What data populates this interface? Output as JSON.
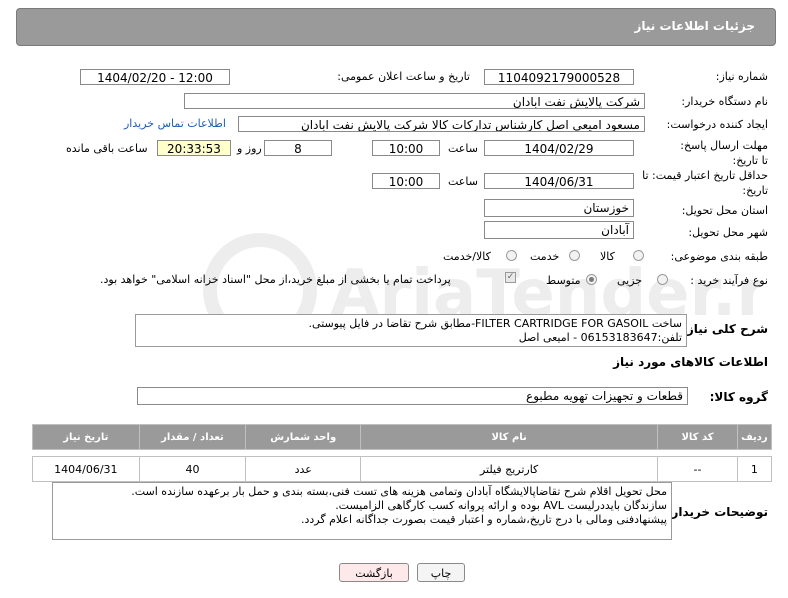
{
  "header": {
    "title": "جزئیات اطلاعات نیاز"
  },
  "fields": {
    "need_number_label": "شماره نیاز:",
    "need_number": "1104092179000528",
    "announce_label": "تاریخ و ساعت اعلان عمومی:",
    "announce_value": "1404/02/20 - 12:00",
    "buyer_org_label": "نام دستگاه خریدار:",
    "buyer_org": "شرکت پالایش نفت ابادان",
    "creator_label": "ایجاد کننده درخواست:",
    "creator": "مسعود امیعی اصل کارشناس تدارکات کالا  شرکت پالایش نفت ابادان",
    "contact_link": "اطلاعات تماس خریدار",
    "reply_deadline_label": "مهلت ارسال پاسخ: تا تاریخ:",
    "reply_date": "1404/02/29",
    "time_label": "ساعت",
    "reply_time": "10:00",
    "days": "8",
    "days_label": "روز و",
    "remaining_time": "20:33:53",
    "remaining_label": "ساعت باقی مانده",
    "price_validity_label": "حداقل تاریخ اعتبار قیمت: تا تاریخ:",
    "price_date": "1404/06/31",
    "price_time_label": "ساعت",
    "price_time": "10:00",
    "province_label": "استان محل تحویل:",
    "province": "خوزستان",
    "city_label": "شهر محل تحویل:",
    "city": "آبادان",
    "category_label": "طبقه بندی موضوعی:",
    "category_options": [
      "کالا",
      "خدمت",
      "کالا/خدمت"
    ],
    "process_label": "نوع فرآیند خرید :",
    "process_options": [
      "جزیی",
      "متوسط"
    ],
    "payment_note": "پرداخت تمام یا بخشی از مبلغ خرید،از محل \"اسناد خزانه اسلامی\" خواهد بود.",
    "description_label": "شرح کلی نیاز:",
    "description_line1": "ساخت FILTER CARTRIDGE FOR GASOIL-مطابق شرح تقاضا در فایل پیوستی.",
    "description_line2": "تلفن:06153183647 - امیعی اصل"
  },
  "goods": {
    "section_title": "اطلاعات کالاهای مورد نیاز",
    "group_label": "گروه کالا:",
    "group_value": "قطعات و تجهیزات تهویه مطبوع",
    "columns": [
      "ردیف",
      "کد کالا",
      "نام کالا",
      "واحد شمارش",
      "تعداد / مقدار",
      "تاریخ نیاز"
    ],
    "rows": [
      {
        "row": "1",
        "code": "--",
        "name": "کارتریج فیلتر",
        "unit": "عدد",
        "qty": "40",
        "date": "1404/06/31"
      }
    ]
  },
  "buyer_notes": {
    "label": "توضیحات خریدار:",
    "line1": "محل تحویل اقلام شرح تقاضاپالایشگاه آبادان وتمامی هزینه های تست فنی،بسته بندی و حمل بار برعهده سازنده است.",
    "line2": "سازندگان بایددرلیست AVL بوده و ارائه پروانه کسب کارگاهی الزامیست.",
    "line3": "پیشنهادفنی ومالی با درج تاریخ،شماره و اعتبار قیمت بصورت جداگانه اعلام گردد."
  },
  "buttons": {
    "print": "چاپ",
    "back": "بازگشت"
  },
  "watermark": {
    "text": "AriaTender.neT"
  }
}
